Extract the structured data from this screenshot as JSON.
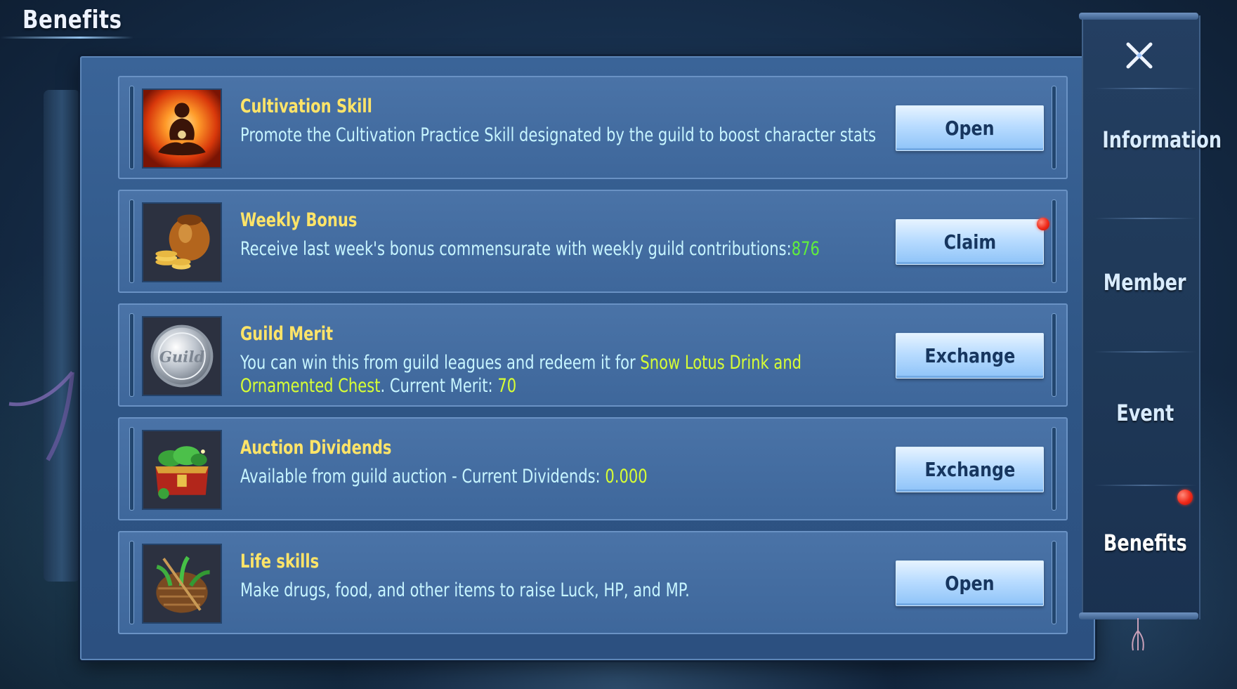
{
  "page_title": "Benefits",
  "colors": {
    "title_yellow": "#ffe468",
    "desc_cyan": "#c7f5ff",
    "highlight_green": "#60ef3c",
    "highlight_lime": "#d8ff34",
    "button_text": "#17365f",
    "notification_red": "#f02a1a"
  },
  "benefits": [
    {
      "icon": "meditation-icon",
      "title": "Cultivation Skill",
      "desc": "Promote the Cultivation Practice Skill designated by the guild to boost character stats",
      "button": "Open"
    },
    {
      "icon": "coin-bag-icon",
      "title": "Weekly Bonus",
      "desc_prefix": "Receive last week's bonus commensurate with weekly guild contributions:",
      "desc_value": "876",
      "button": "Claim",
      "has_notification": true
    },
    {
      "icon": "guild-coin-icon",
      "coin_text": "Guild",
      "title": "Guild Merit",
      "desc_prefix": "You can win this from guild leagues and redeem it for ",
      "desc_highlight": "Snow Lotus Drink and Ornamented Chest",
      "desc_middle": ". Current Merit: ",
      "desc_value": "70",
      "button": "Exchange"
    },
    {
      "icon": "treasure-chest-icon",
      "title": "Auction Dividends",
      "desc_prefix": "Available from guild auction - Current Dividends: ",
      "desc_value": "0.000",
      "button": "Exchange"
    },
    {
      "icon": "herb-basket-icon",
      "title": "Life skills",
      "desc": "Make drugs, food, and other items to raise Luck, HP, and MP.",
      "button": "Open"
    }
  ],
  "side_nav": {
    "close_icon": "close-x-icon",
    "items": [
      {
        "label": "Information",
        "active": false
      },
      {
        "label": "Member",
        "active": false
      },
      {
        "label": "Event",
        "active": false
      },
      {
        "label": "Benefits",
        "active": true,
        "has_notification": true
      }
    ]
  }
}
